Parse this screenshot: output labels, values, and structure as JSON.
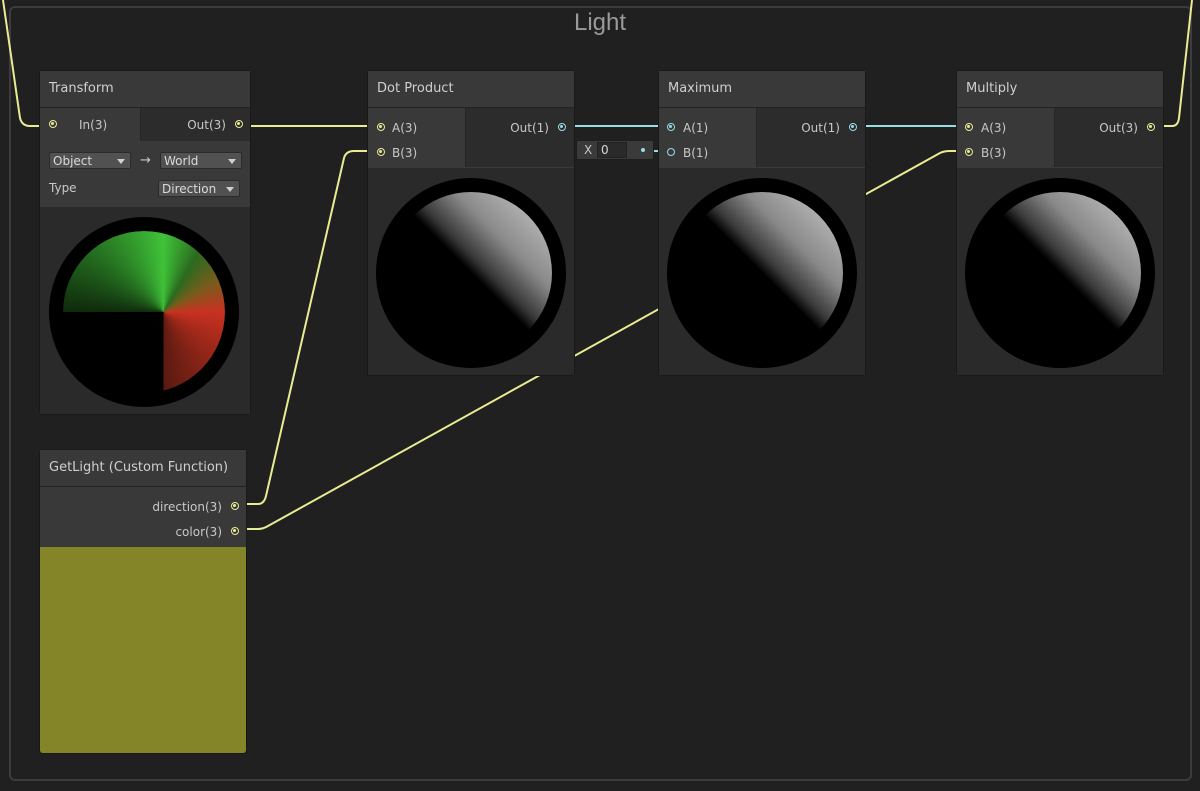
{
  "group": {
    "title": "Light"
  },
  "nodes": {
    "transform": {
      "title": "Transform",
      "input": "In(3)",
      "output": "Out(3)",
      "from_space": "Object",
      "arrow": "→",
      "to_space": "World",
      "type_label": "Type",
      "type_value": "Direction"
    },
    "dot_product": {
      "title": "Dot Product",
      "input_a": "A(3)",
      "input_b": "B(3)",
      "output": "Out(1)"
    },
    "maximum": {
      "title": "Maximum",
      "input_a": "A(1)",
      "input_b": "B(1)",
      "output": "Out(1)",
      "b_field_label": "X",
      "b_field_value": "0"
    },
    "multiply": {
      "title": "Multiply",
      "input_a": "A(3)",
      "input_b": "B(3)",
      "output": "Out(3)"
    },
    "get_light": {
      "title": "GetLight (Custom Function)",
      "output_direction": "direction(3)",
      "output_color": "color(3)",
      "preview_color": "#848429"
    }
  },
  "colors": {
    "vector3_wire": "#e9ec93",
    "vector1_wire": "#96dde8",
    "background": "#202020",
    "node_body": "#393939"
  }
}
